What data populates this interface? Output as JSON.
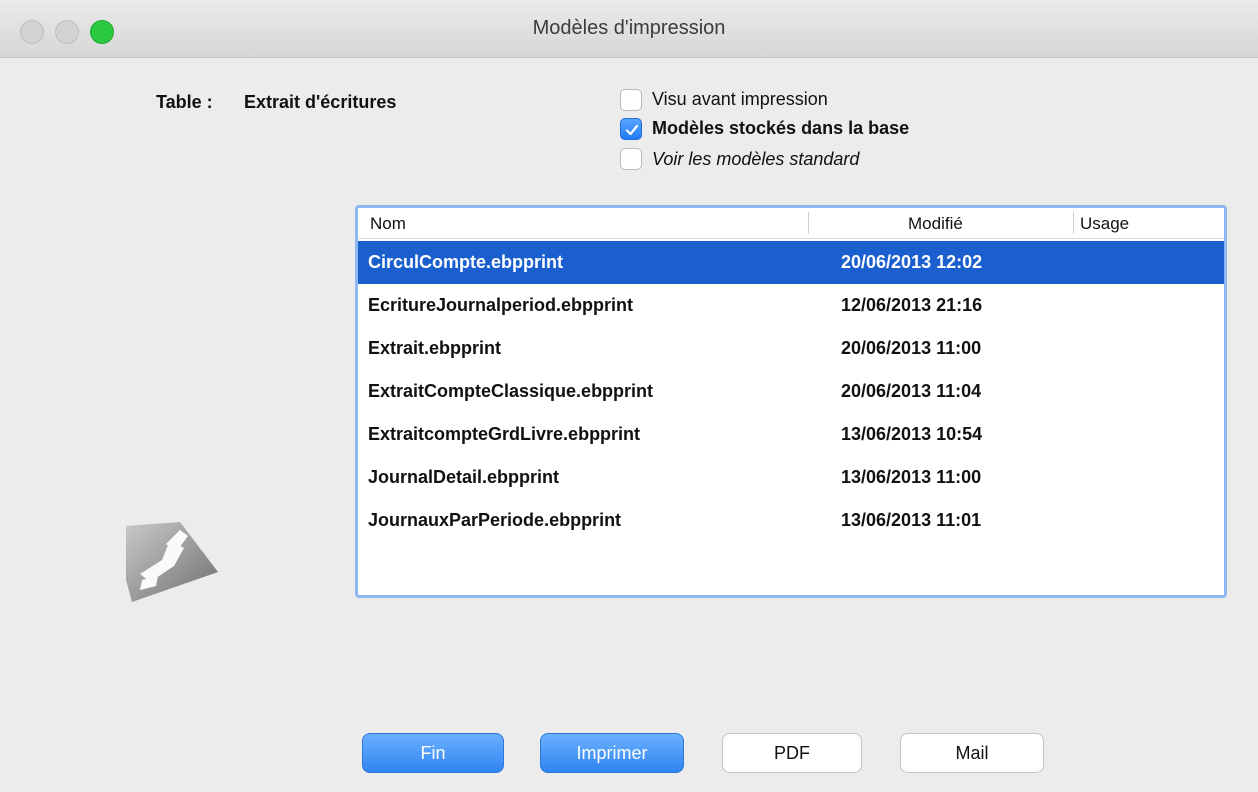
{
  "window": {
    "title": "Modèles d'impression"
  },
  "table": {
    "label": "Table :",
    "value": "Extrait d'écritures"
  },
  "options": [
    {
      "label": "Visu avant impression",
      "checked": false
    },
    {
      "label": "Modèles stockés dans la base",
      "checked": true
    },
    {
      "label": "Voir les modèles standard",
      "checked": false
    }
  ],
  "list": {
    "columns": [
      "Nom",
      "Modifié",
      "Usage"
    ],
    "rows": [
      {
        "name": "CirculCompte.ebpprint",
        "modified": "20/06/2013 12:02",
        "usage": "",
        "selected": true
      },
      {
        "name": "EcritureJournalperiod.ebpprint",
        "modified": "12/06/2013 21:16",
        "usage": ""
      },
      {
        "name": "Extrait.ebpprint",
        "modified": "20/06/2013 11:00",
        "usage": ""
      },
      {
        "name": "ExtraitCompteClassique.ebpprint",
        "modified": "20/06/2013 11:04",
        "usage": ""
      },
      {
        "name": "ExtraitcompteGrdLivre.ebpprint",
        "modified": "13/06/2013 10:54",
        "usage": ""
      },
      {
        "name": "JournalDetail.ebpprint",
        "modified": "13/06/2013 11:00",
        "usage": ""
      },
      {
        "name": "JournauxParPeriode.ebpprint",
        "modified": "13/06/2013 11:01",
        "usage": ""
      }
    ]
  },
  "buttons": {
    "fin": "Fin",
    "imprimer": "Imprimer",
    "pdf": "PDF",
    "mail": "Mail"
  },
  "logo_icon": "app-logo-icon",
  "colors": {
    "selection": "#1b5fcf",
    "accent": "#2f85f0",
    "focus_ring": "#8fb8f1"
  }
}
